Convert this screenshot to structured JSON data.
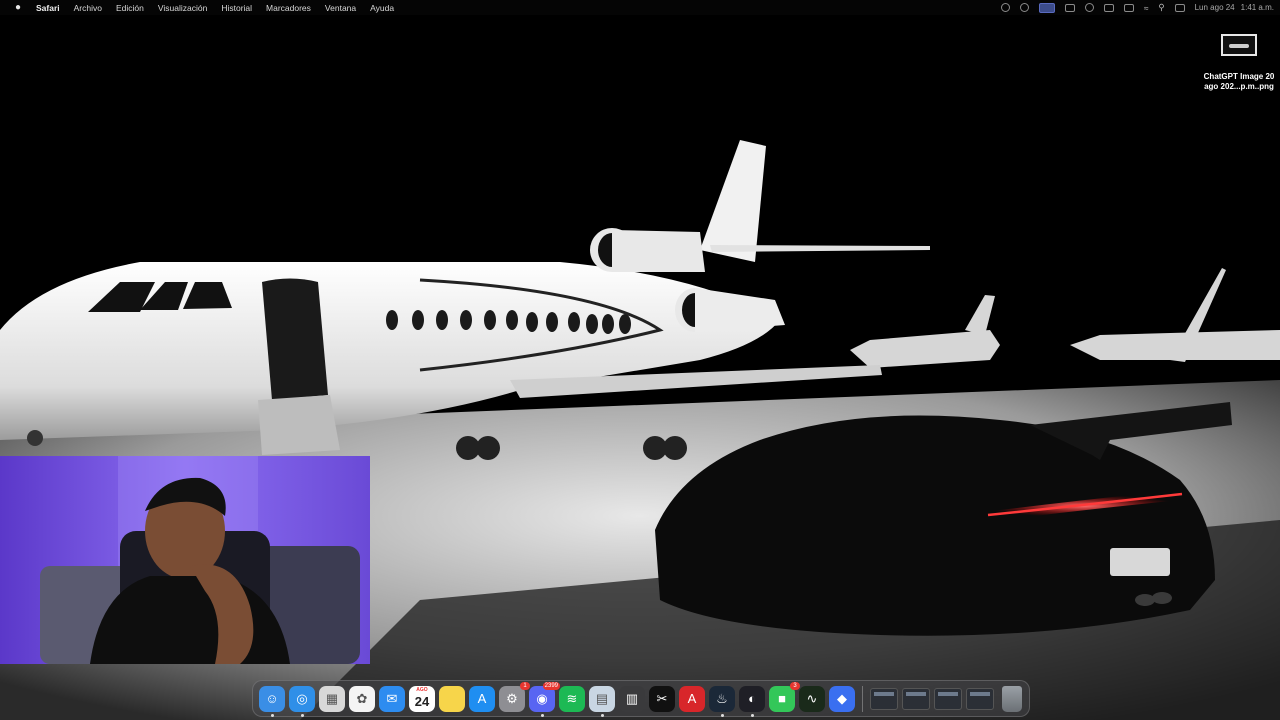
{
  "menubar": {
    "apple_icon": "apple-icon",
    "app_name": "Safari",
    "items": [
      "Archivo",
      "Edición",
      "Visualización",
      "Historial",
      "Marcadores",
      "Ventana",
      "Ayuda"
    ],
    "clock": {
      "date": "Lun ago 24",
      "time": "1:41 a.m."
    }
  },
  "desktop": {
    "file": {
      "name_line1": "ChatGPT Image 20",
      "name_line2": "ago 202...p.m..png"
    }
  },
  "dock": {
    "apps": [
      {
        "name": "finder",
        "icon": "finder-icon",
        "color": "#3a8ee6",
        "glyph": "☺",
        "running": true
      },
      {
        "name": "safari",
        "icon": "safari-icon",
        "color": "#2f8fe8",
        "glyph": "◎",
        "running": true
      },
      {
        "name": "launchpad",
        "icon": "launchpad-icon",
        "color": "#d8d8d8",
        "glyph": "▦",
        "running": false
      },
      {
        "name": "photos",
        "icon": "photos-icon",
        "color": "#f4f4f4",
        "glyph": "✿",
        "running": false
      },
      {
        "name": "mail",
        "icon": "mail-icon",
        "color": "#2d8cf0",
        "glyph": "✉",
        "running": false
      },
      {
        "name": "calendar",
        "icon": "calendar-icon",
        "color": "#ffffff",
        "month": "AGO",
        "day": "24",
        "running": false
      },
      {
        "name": "notes",
        "icon": "notes-icon",
        "color": "#f7d54a",
        "glyph": "",
        "running": false
      },
      {
        "name": "app-store",
        "icon": "app-store-icon",
        "color": "#1f8ef1",
        "glyph": "A",
        "running": false
      },
      {
        "name": "system-settings",
        "icon": "gear-icon",
        "color": "#8e8e93",
        "glyph": "⚙",
        "badge": "1",
        "running": false
      },
      {
        "name": "discord",
        "icon": "discord-icon",
        "color": "#5865f2",
        "glyph": "◉",
        "badge": "2399",
        "running": true
      },
      {
        "name": "spotify",
        "icon": "spotify-icon",
        "color": "#1db954",
        "glyph": "≋",
        "running": false
      },
      {
        "name": "preview",
        "icon": "preview-icon",
        "color": "#c9d6e3",
        "glyph": "▤",
        "running": true
      },
      {
        "name": "calculator",
        "icon": "calculator-icon",
        "color": "#3a3a3c",
        "glyph": "▥",
        "running": false
      },
      {
        "name": "capcut",
        "icon": "capcut-icon",
        "color": "#111111",
        "glyph": "✂",
        "running": false
      },
      {
        "name": "acrobat",
        "icon": "acrobat-icon",
        "color": "#d8262a",
        "glyph": "A",
        "running": false
      },
      {
        "name": "steam",
        "icon": "steam-icon",
        "color": "#1b2838",
        "glyph": "♨",
        "running": true
      },
      {
        "name": "obs",
        "icon": "obs-icon",
        "color": "#1f1f26",
        "glyph": "◐",
        "running": true
      },
      {
        "name": "facetime",
        "icon": "facetime-icon",
        "color": "#33c759",
        "glyph": "■",
        "badge": "3",
        "running": false
      },
      {
        "name": "activity-monitor",
        "icon": "activity-monitor-icon",
        "color": "#1a2a1a",
        "glyph": "∿",
        "running": false
      },
      {
        "name": "roblox",
        "icon": "roblox-icon",
        "color": "#3a6ff0",
        "glyph": "◆",
        "running": false
      }
    ],
    "windows": [
      "minimized-window-1",
      "minimized-window-2",
      "minimized-window-3",
      "minimized-window-4"
    ]
  },
  "colors": {
    "menubar_text": "#d8d8d8",
    "taillight": "#ff2a2a",
    "webcam_bg": "#7a5ae0"
  }
}
